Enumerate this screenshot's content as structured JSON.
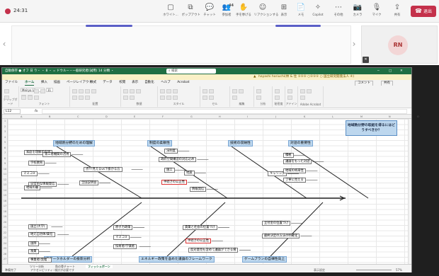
{
  "teams": {
    "timer": "24:31",
    "toolbar": [
      {
        "name": "whiteboard-button",
        "icon": "▢",
        "label": "ホワイト..."
      },
      {
        "name": "popout-button",
        "icon": "⧉",
        "label": "ポップアウト"
      },
      {
        "name": "chat-button",
        "icon": "💬",
        "label": "チャット"
      },
      {
        "name": "people-button",
        "icon": "👥",
        "label": "参加者",
        "badge": "44"
      },
      {
        "name": "raise-hand-button",
        "icon": "✋",
        "label": "手を挙げる"
      },
      {
        "name": "react-button",
        "icon": "☺",
        "label": "リアクションする"
      },
      {
        "name": "view-button",
        "icon": "⊞",
        "label": "表示"
      },
      {
        "name": "notes-button",
        "icon": "📄",
        "label": "メモ"
      },
      {
        "name": "copilot-button",
        "icon": "✧",
        "label": "Copilot"
      },
      {
        "name": "more-button",
        "icon": "⋯",
        "label": "その他"
      },
      {
        "name": "camera-button",
        "icon": "📷",
        "label": "カメラ"
      },
      {
        "name": "mic-button",
        "icon": "🎙",
        "label": "マイク"
      },
      {
        "name": "share-button",
        "icon": "⇪",
        "label": "共有"
      }
    ],
    "leave_label": "退出",
    "participant_initials": "RN"
  },
  "excel": {
    "title_bar": "自動保存 ● オフ  日 り・ ・ 8 ・ = ドウルー・一般研究者(試用) 14 分類 ・",
    "search_placeholder": "検索",
    "warning": "hayashi horiuchi(林 & 住 ⑤⑤⑤ ○⑤⑤⑤ ○ 国立研究開発法人 ④)",
    "menus": [
      "ファイル",
      "ホーム",
      "挿入",
      "描画",
      "ページレイアウト",
      "数式",
      "データ",
      "校閲",
      "表示",
      "自動化",
      "ヘルプ",
      "Acrobat"
    ],
    "comment_label": "コメント",
    "share_label": "共有",
    "ribbon_groups": [
      "クリップボード",
      "フォント",
      "配置",
      "数値",
      "スタイル",
      "セル",
      "編集",
      "分析",
      "秘密度",
      "アドイン",
      "Adobe Acrobat"
    ],
    "font_name": "Meiryo UI",
    "font_size": "11",
    "cell_ref": "L12",
    "fx": "fx",
    "columns": [
      "A",
      "B",
      "C",
      "D",
      "E",
      "F",
      "G",
      "H",
      "I",
      "J",
      "K",
      "L",
      "M",
      "N",
      "O"
    ],
    "rows": [
      "1",
      "2",
      "3",
      "4",
      "5",
      "6",
      "7",
      "8",
      "9",
      "10",
      "11",
      "12",
      "13",
      "14",
      "15",
      "16",
      "17",
      "18",
      "19",
      "20",
      "21",
      "22",
      "23",
      "24",
      "25",
      "26",
      "27"
    ],
    "sheets": [
      "ツリー分析",
      "魚の骨チャート",
      "フィッシュボーン"
    ],
    "active_sheet": 2,
    "status_left": "準備完了",
    "status_access": "アクセシビリティ: 検討が必要です",
    "status_settings": "表示設定",
    "zoom": "57%"
  },
  "fishbone": {
    "effect": "地域熱分野の取組を得るにはどうすべきか？",
    "categories_top": [
      "地域熱分野のための理解",
      "制度の柔軟性",
      "技術の収納性",
      "対話の重要性"
    ],
    "categories_bottom": [
      "ステークホルダーの投影分析",
      "エネルギー政策を含めた議論のフレームワーク",
      "ゲームプランの自律性向上"
    ],
    "causes": [
      "家庭を理解の内容",
      "学校教育",
      "マスコミ",
      "第三者機関の活用",
      "日常的な情報発信",
      "点!!!見えるvs下掛かる方",
      "地域の暮",
      "全国説明会",
      "法制度",
      "政府空間構造の対応込め",
      "施工",
      "地震",
      "手続きの公正性",
      "情報発信",
      "キャリング",
      "積極",
      "議論をもった対話",
      "地域の将来性",
      "丁寧に見える",
      "国立(大学)",
      "地元自治体/責任",
      "国際",
      "漁業",
      "事業者(発電...",
      "原子力政策",
      "マスコミ",
      "技術者/学識者",
      "貨業と社会の位置づけ",
      "手続きの公正性",
      "反対意見も含めて議論ができる場",
      "立付金の位置づけ",
      "最終決定の方法の明確化"
    ]
  }
}
